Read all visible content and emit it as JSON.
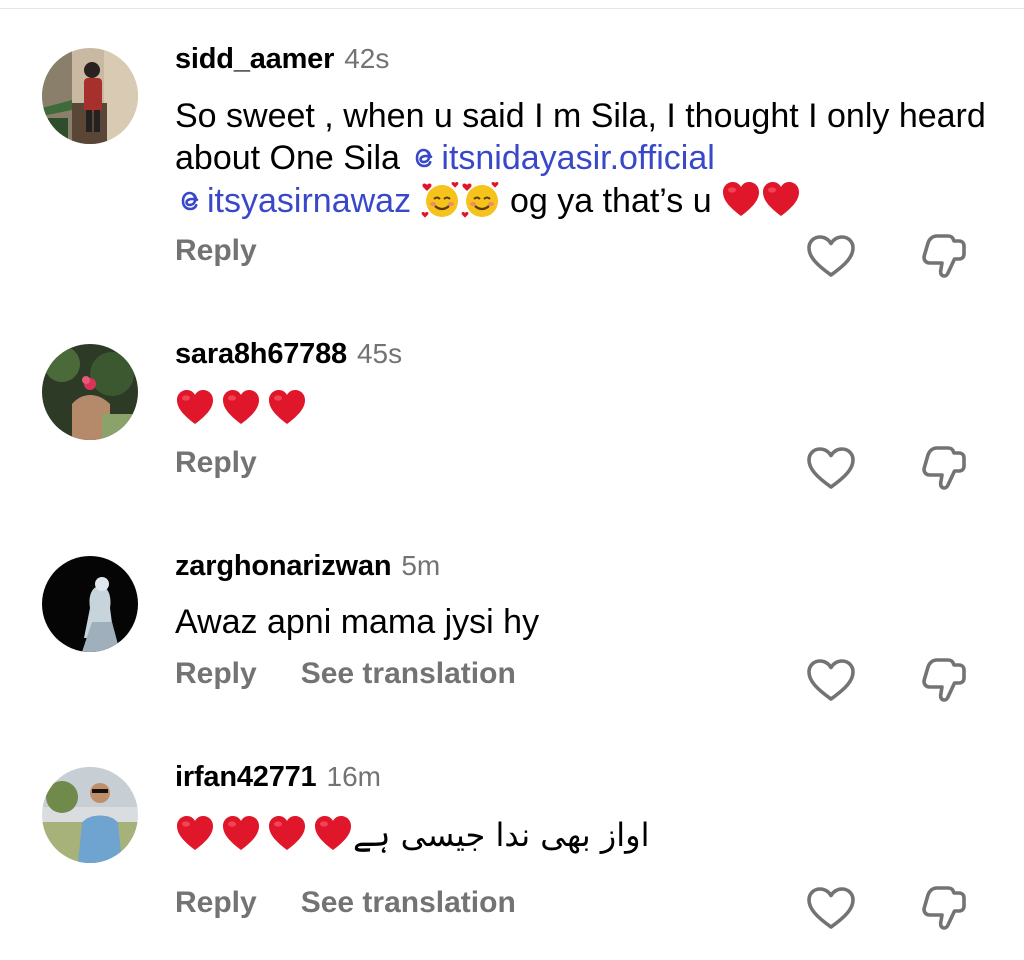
{
  "comments": [
    {
      "username": "sidd_aamer",
      "time": "42s",
      "text_part1": "So sweet , when u said I m Sila, I thought I only heard about One Sila ",
      "mention1": "itsnidayasir.official",
      "mention2": "itsyasirnawaz",
      "text_part2": " og ya that’s u ",
      "reply_label": "Reply",
      "avatar_icon": "user-photo-avatar"
    },
    {
      "username": "sara8h67788",
      "time": "45s",
      "reply_label": "Reply",
      "avatar_icon": "user-photo-avatar"
    },
    {
      "username": "zarghonarizwan",
      "time": "5m",
      "text": "Awaz apni mama jysi hy",
      "reply_label": "Reply",
      "translate_label": "See translation",
      "avatar_icon": "user-photo-avatar"
    },
    {
      "username": "irfan42771",
      "time": "16m",
      "text_urdu": "اواز بھی ندا جیسی ہے",
      "reply_label": "Reply",
      "translate_label": "See translation",
      "avatar_icon": "user-photo-avatar"
    }
  ],
  "colors": {
    "mention": "#3848c8",
    "muted": "#737373",
    "heart": "#e0162b"
  },
  "icons": {
    "like": "heart-outline-icon",
    "dislike": "thumbs-down-outline-icon",
    "mention_glyph": "threads-at-icon"
  }
}
